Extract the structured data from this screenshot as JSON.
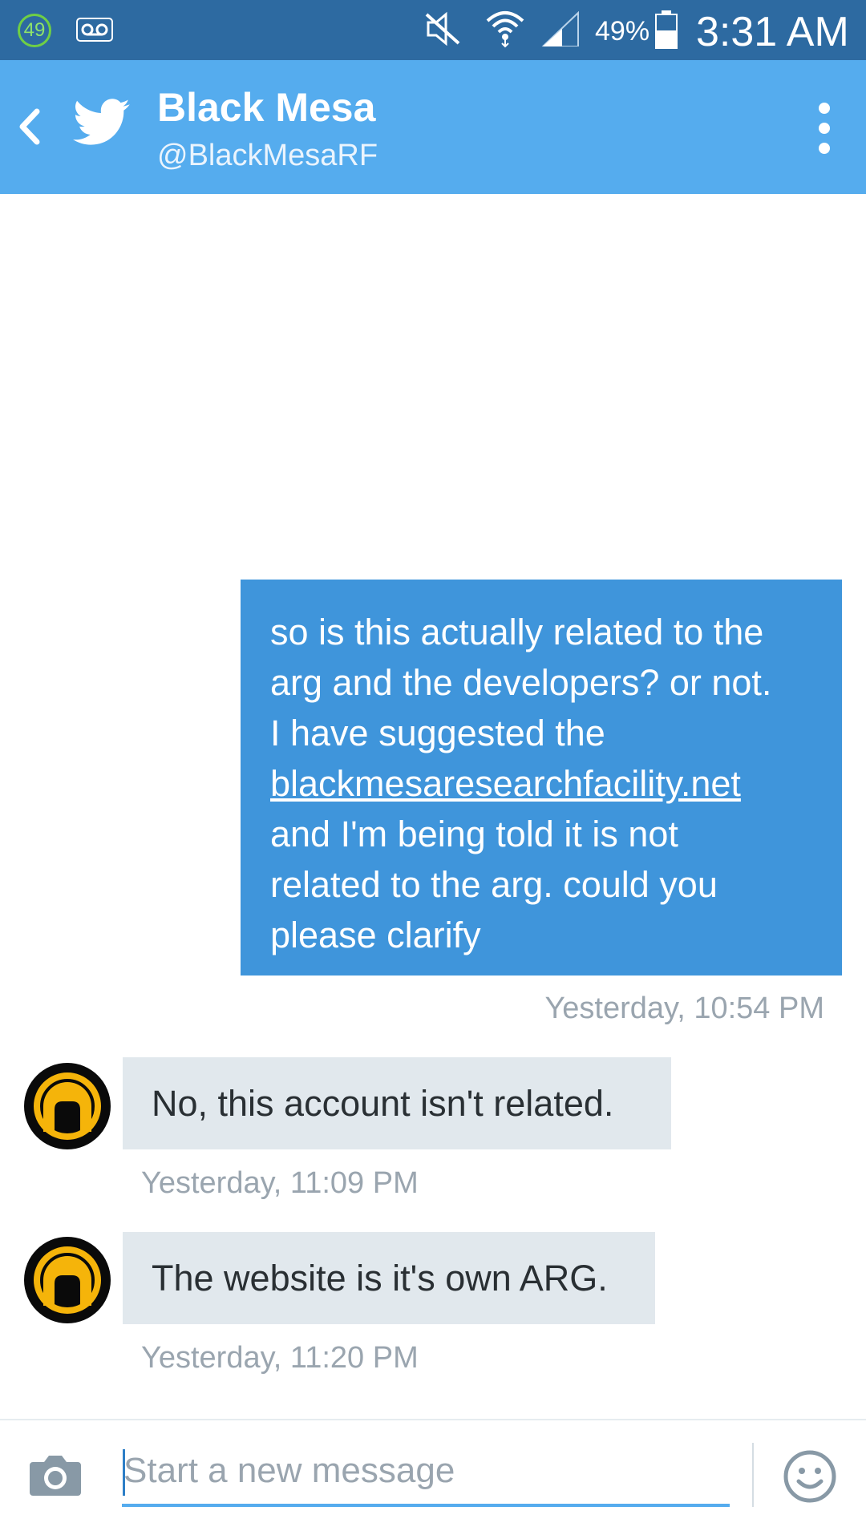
{
  "status_bar": {
    "notification_count": "49",
    "battery_percent": "49%",
    "time": "3:31 AM",
    "icons": [
      "voicemail-icon",
      "mute-icon",
      "wifi-icon",
      "signal-icon",
      "battery-icon"
    ]
  },
  "header": {
    "title": "Black Mesa",
    "handle": "@BlackMesaRF",
    "accent_color": "#55acee"
  },
  "messages": [
    {
      "direction": "outgoing",
      "lines": [
        "so is this actually related to the",
        "arg and the developers? or not.",
        "I have suggested the"
      ],
      "link": "blackmesaresearchfacility.net",
      "lines_after": [
        "and I'm being told  it is not",
        "related to the arg.  could you",
        "please clarify"
      ],
      "timestamp": "Yesterday, 10:54 PM"
    },
    {
      "direction": "incoming",
      "text": "No, this account isn't related.",
      "timestamp": "Yesterday, 11:09 PM"
    },
    {
      "direction": "incoming",
      "text": "The website is it's own ARG.",
      "timestamp": "Yesterday, 11:20 PM"
    }
  ],
  "composer": {
    "placeholder": "Start a new message"
  },
  "colors": {
    "status_bar": "#2d6aa1",
    "header": "#55acee",
    "outgoing_bubble": "#3f95db",
    "incoming_bubble": "#e1e8ed"
  }
}
